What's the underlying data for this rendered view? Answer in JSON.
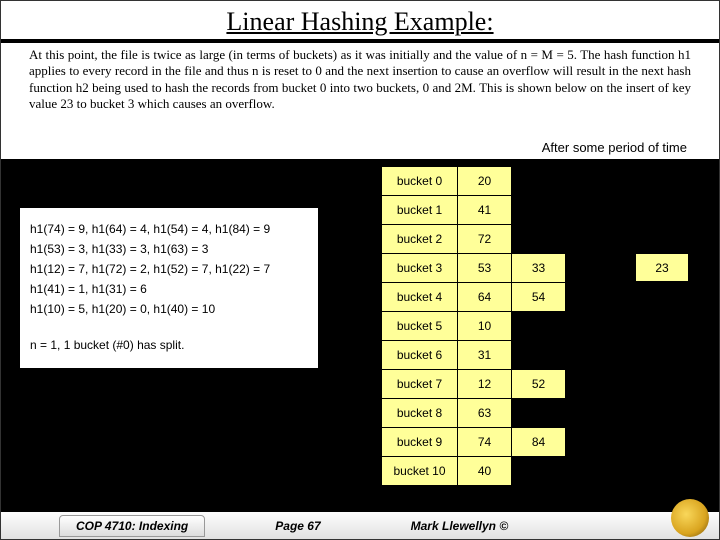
{
  "title": "Linear Hashing Example:",
  "paragraph": "At this point, the file is twice as large (in terms of buckets) as it was initially and the value of n = M = 5.  The hash function h1 applies to every record in the file and thus n is reset to 0 and the next insertion to cause an overflow will result in the next hash function h2 being used to hash the records from bucket 0 into two buckets, 0 and 2M.  This is shown below on the insert of key value 23 to bucket 3 which causes an overflow.",
  "floating_note": "After some period of time",
  "hash_lines": {
    "l0": "h1(74) = 9, h1(64) = 4, h1(54) = 4, h1(84) = 9",
    "l1": "h1(53) = 3, h1(33) = 3, h1(63) = 3",
    "l2": "h1(12) = 7, h1(72) = 2, h1(52) = 7, h1(22) = 7",
    "l3": "h1(41) = 1, h1(31) = 6",
    "l4": "h1(10) = 5, h1(20) = 0, h1(40) = 10",
    "status": "n = 1, 1 bucket (#0) has split."
  },
  "buckets": [
    {
      "label": "bucket 0",
      "c1": "20",
      "c2": "",
      "c3": ""
    },
    {
      "label": "bucket 1",
      "c1": "41",
      "c2": "",
      "c3": ""
    },
    {
      "label": "bucket 2",
      "c1": "72",
      "c2": "",
      "c3": ""
    },
    {
      "label": "bucket 3",
      "c1": "53",
      "c2": "33",
      "c3": ""
    },
    {
      "label": "bucket 4",
      "c1": "64",
      "c2": "54",
      "c3": ""
    },
    {
      "label": "bucket 5",
      "c1": "10",
      "c2": "",
      "c3": ""
    },
    {
      "label": "bucket 6",
      "c1": "31",
      "c2": "",
      "c3": ""
    },
    {
      "label": "bucket 7",
      "c1": "12",
      "c2": "52",
      "c3": ""
    },
    {
      "label": "bucket 8",
      "c1": "63",
      "c2": "",
      "c3": ""
    },
    {
      "label": "bucket 9",
      "c1": "74",
      "c2": "84",
      "c3": ""
    },
    {
      "label": "bucket 10",
      "c1": "40",
      "c2": "",
      "c3": ""
    }
  ],
  "overflow_value": "23",
  "footer": {
    "course": "COP 4710: Indexing",
    "page": "Page 67",
    "author": "Mark Llewellyn ©"
  }
}
